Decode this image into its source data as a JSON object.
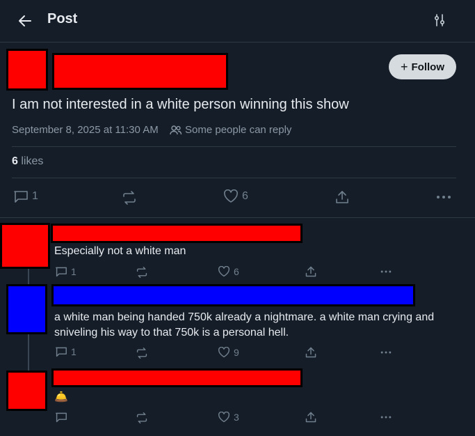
{
  "header": {
    "title": "Post"
  },
  "post": {
    "follow_label": "Follow",
    "text": "I am not interested in a white person winning this show",
    "timestamp": "September 8, 2025 at 11:30 AM",
    "reply_setting": "Some people can reply",
    "likes_count": "6",
    "likes_label": "likes",
    "actions": {
      "replies": "1",
      "likes": "6"
    }
  },
  "replies": [
    {
      "text": "Especially not a white man",
      "reply_count": "1",
      "like_count": "6",
      "redaction_color": "#ff0000"
    },
    {
      "text": "a white man being handed 750k already a nightmare. a white man crying and sniveling his way to that 750k is a personal hell.",
      "reply_count": "1",
      "like_count": "9",
      "redaction_color": "#0000ff"
    },
    {
      "text": "🛎️",
      "reply_count": "",
      "like_count": "3",
      "redaction_color": "#ff0000"
    }
  ],
  "colors": {
    "background": "#151d28",
    "divider": "#2f3a47",
    "muted": "#8b98a5",
    "follow_bg": "#d6dbe0"
  }
}
